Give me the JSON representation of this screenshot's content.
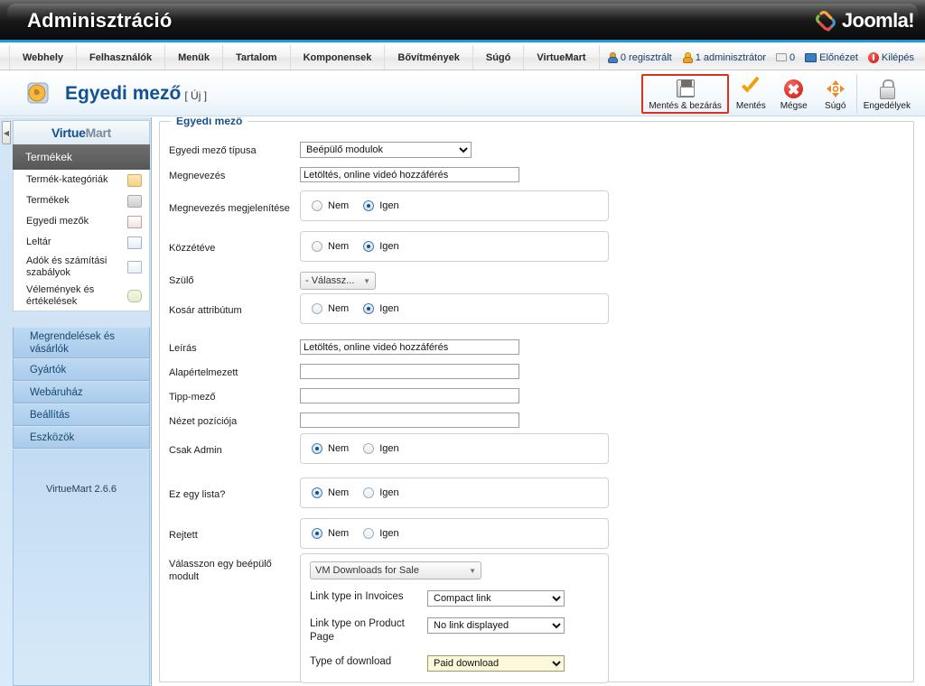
{
  "header": {
    "admin_title": "Adminisztráció",
    "logo_text": "Joomla!"
  },
  "menu": {
    "items": [
      {
        "label": "Webhely"
      },
      {
        "label": "Felhasználók"
      },
      {
        "label": "Menük"
      },
      {
        "label": "Tartalom"
      },
      {
        "label": "Komponensek"
      },
      {
        "label": "Bővítmények"
      },
      {
        "label": "Súgó"
      },
      {
        "label": "VirtueMart"
      }
    ],
    "status": {
      "registered": "0 regisztrált",
      "administrators": "1 adminisztrátor",
      "messages": "0",
      "preview": "Előnézet",
      "logout": "Kilépés"
    }
  },
  "page": {
    "title": "Egyedi mező",
    "subtitle": "[ Új ]"
  },
  "toolbar": {
    "buttons": [
      {
        "label": "Mentés & bezárás",
        "icon": "save-icon",
        "highlighted": true
      },
      {
        "label": "Mentés",
        "icon": "check-icon",
        "highlighted": false
      },
      {
        "label": "Mégse",
        "icon": "cancel-icon",
        "highlighted": false
      },
      {
        "label": "Súgó",
        "icon": "help-icon",
        "highlighted": false
      },
      {
        "label": "Engedélyek",
        "icon": "lock-icon",
        "highlighted": false
      }
    ]
  },
  "sidebar": {
    "logo_primary": "Virtue",
    "logo_secondary": "Mart",
    "group_header": "Termékek",
    "sub_items": [
      {
        "label": "Termék-kategóriák",
        "icon": "folder-icon"
      },
      {
        "label": "Termékek",
        "icon": "camera-icon"
      },
      {
        "label": "Egyedi mezők",
        "icon": "document-icon"
      },
      {
        "label": "Leltár",
        "icon": "chart-icon"
      },
      {
        "label": "Adók és számítási szabályok",
        "icon": "grid-icon"
      },
      {
        "label": "Vélemények és értékelések",
        "icon": "chat-icon"
      }
    ],
    "links": [
      {
        "label": "Megrendelések és vásárlók"
      },
      {
        "label": "Gyártók"
      },
      {
        "label": "Webáruház"
      },
      {
        "label": "Beállítás"
      },
      {
        "label": "Eszközök"
      }
    ],
    "version": "VirtueMart 2.6.6"
  },
  "form": {
    "legend": "Egyedi mező",
    "radio_no": "Nem",
    "radio_yes": "Igen",
    "fields": {
      "type": {
        "label": "Egyedi mező típusa",
        "value": "Beépülő modulok"
      },
      "title": {
        "label": "Megnevezés",
        "value": "Letöltés, online videó hozzáférés"
      },
      "show_title": {
        "label": "Megnevezés megjelenítése",
        "selected": "Igen"
      },
      "published": {
        "label": "Közzétéve",
        "selected": "Igen"
      },
      "parent": {
        "label": "Szülő",
        "value": "- Válassz..."
      },
      "cart_attribute": {
        "label": "Kosár attribútum",
        "selected": "Igen"
      },
      "description": {
        "label": "Leírás",
        "value": "Letöltés, online videó hozzáférés"
      },
      "default": {
        "label": "Alapértelmezett",
        "value": ""
      },
      "tooltip": {
        "label": "Tipp-mező",
        "value": ""
      },
      "layout_position": {
        "label": "Nézet pozíciója",
        "value": ""
      },
      "admin_only": {
        "label": "Csak Admin",
        "selected": "Nem"
      },
      "is_list": {
        "label": "Ez egy lista?",
        "selected": "Nem"
      },
      "hidden": {
        "label": "Rejtett",
        "selected": "Nem"
      },
      "select_plugin": {
        "label": "Válasszon egy beépülő modult",
        "value": "VM Downloads for Sale"
      }
    },
    "plugin_panel": {
      "rows": [
        {
          "label": "Link type in Invoices",
          "value": "Compact link",
          "highlighted": false
        },
        {
          "label": "Link type on Product Page",
          "value": "No link displayed",
          "highlighted": false
        },
        {
          "label": "Type of download",
          "value": "Paid download",
          "highlighted": true
        }
      ]
    }
  },
  "colors": {
    "accent_blue": "#1a9bd7",
    "title_blue": "#14528f",
    "highlight_red": "#e03018",
    "highlight_yellow": "#fbf8dc"
  }
}
